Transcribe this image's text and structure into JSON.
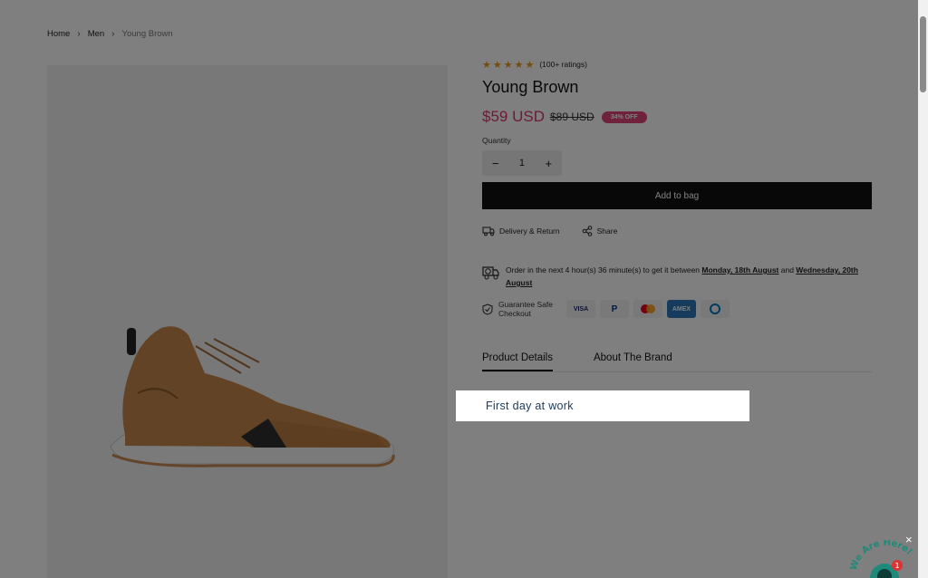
{
  "breadcrumb": {
    "home": "Home",
    "category": "Men",
    "current": "Young Brown"
  },
  "product": {
    "title": "Young Brown",
    "rating_text": "(100+ ratings)",
    "stars": "★★★★★",
    "price": "$59 USD",
    "old_price": "$89 USD",
    "discount": "34% OFF",
    "quantity_label": "Quantity",
    "quantity": "1",
    "minus": "−",
    "plus": "+",
    "add_to_bag": "Add to bag"
  },
  "links": {
    "delivery": "Delivery & Return",
    "share": "Share"
  },
  "delivery": {
    "prefix": "Order in the next 4 hour(s) 36 minute(s) to get it between ",
    "date_from": "Monday, 18th August",
    "middle": " and ",
    "date_to": "Wednesday, 20th August"
  },
  "checkout": {
    "label": "Guarantee Safe Checkout",
    "methods": [
      "VISA",
      "P",
      "",
      "AMEX",
      ""
    ]
  },
  "tabs": [
    "Product Details",
    "About The Brand"
  ],
  "highlight": {
    "text": "First day at work"
  },
  "chat": {
    "label": "We Are Here!",
    "badge": "1",
    "close": "×"
  },
  "colors": {
    "accent": "#d8376a",
    "discount_bg": "#e0457a",
    "button_bg": "#111111",
    "star": "#e89b1c"
  }
}
